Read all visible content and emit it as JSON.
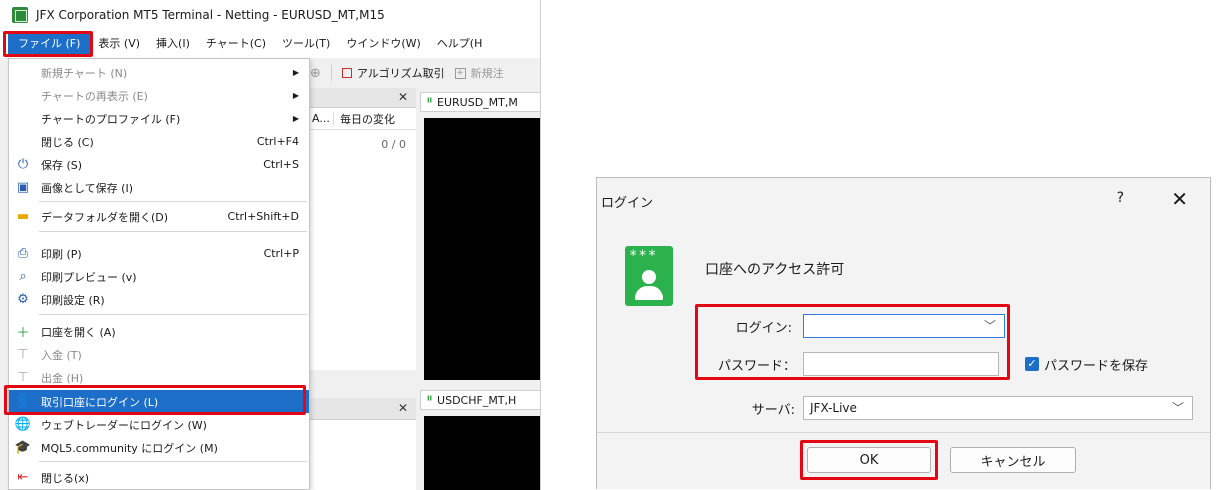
{
  "terminal": {
    "title": "JFX Corporation MT5 Terminal - Netting - EURUSD_MT,M15",
    "menu": [
      "ファイル (F)",
      "表示 (V)",
      "挿入(I)",
      "チャート(C)",
      "ツール(T)",
      "ウインドウ(W)",
      "ヘルプ(H"
    ],
    "toolbar": {
      "algo_trading": "アルゴリズム取引",
      "new_order": "新規注"
    },
    "market_watch": {
      "col_truncated": "A...",
      "col_daily_change": "毎日の変化",
      "value": "0 / 0"
    },
    "charts": [
      {
        "tab": "EURUSD_MT,M"
      },
      {
        "tab": "USDCHF_MT,H"
      }
    ],
    "file_menu": [
      {
        "label": "新規チャート (N)",
        "shortcut": "",
        "icon": "",
        "disabled": true,
        "submenu": true
      },
      {
        "label": "チャートの再表示 (E)",
        "shortcut": "",
        "icon": "",
        "disabled": true,
        "submenu": true
      },
      {
        "label": "チャートのプロファイル (F)",
        "shortcut": "",
        "icon": "",
        "disabled": false,
        "submenu": true
      },
      {
        "label": "閉じる (C)",
        "shortcut": "Ctrl+F4",
        "icon": "",
        "disabled": false,
        "submenu": false
      },
      {
        "label": "保存 (S)",
        "shortcut": "Ctrl+S",
        "icon": "save-icon",
        "disabled": false,
        "submenu": false
      },
      {
        "label": "画像として保存 (I)",
        "shortcut": "",
        "icon": "image-icon",
        "disabled": false,
        "submenu": false
      },
      {
        "label": "データフォルダを開く(D)",
        "shortcut": "Ctrl+Shift+D",
        "icon": "folder-icon",
        "disabled": false,
        "submenu": false
      },
      {
        "label": "印刷 (P)",
        "shortcut": "Ctrl+P",
        "icon": "printer-icon",
        "disabled": false,
        "submenu": false
      },
      {
        "label": "印刷プレビュー (v)",
        "shortcut": "",
        "icon": "print-preview-icon",
        "disabled": false,
        "submenu": false
      },
      {
        "label": "印刷設定 (R)",
        "shortcut": "",
        "icon": "print-settings-icon",
        "disabled": false,
        "submenu": false
      },
      {
        "label": "口座を開く (A)",
        "shortcut": "",
        "icon": "plus-icon",
        "disabled": false,
        "submenu": false
      },
      {
        "label": "入金 (T)",
        "shortcut": "",
        "icon": "deposit-icon",
        "disabled": true,
        "submenu": false
      },
      {
        "label": "出金 (H)",
        "shortcut": "",
        "icon": "withdraw-icon",
        "disabled": true,
        "submenu": false
      },
      {
        "label": "取引口座にログイン (L)",
        "shortcut": "",
        "icon": "user-icon",
        "disabled": false,
        "submenu": false,
        "highlighted": true
      },
      {
        "label": "ウェブトレーダーにログイン (W)",
        "shortcut": "",
        "icon": "globe-icon",
        "disabled": false,
        "submenu": false
      },
      {
        "label": "MQL5.community にログイン (M)",
        "shortcut": "",
        "icon": "mortarboard-icon",
        "disabled": false,
        "submenu": false
      },
      {
        "label": "閉じる(x)",
        "shortcut": "",
        "icon": "exit-icon",
        "disabled": false,
        "submenu": false
      }
    ]
  },
  "login_dialog": {
    "title": "ログイン",
    "help": "?",
    "close": "✕",
    "heading": "口座へのアクセス許可",
    "login_label": "ログイン:",
    "login_value": "",
    "password_label": "パスワード：",
    "password_value": "",
    "save_password_label": "パスワードを保存",
    "save_password_checked": true,
    "server_label": "サーバ:",
    "server_value": "JFX-Live",
    "ok": "OK",
    "cancel": "キャンセル"
  },
  "colors": {
    "highlight": "#1d6ec9",
    "annotation_red": "#e30613",
    "account_icon_green": "#2bb24c"
  }
}
